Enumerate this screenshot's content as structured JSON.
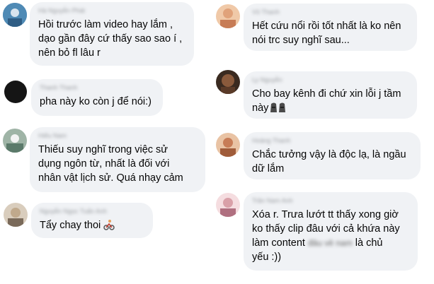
{
  "comments": [
    {
      "name": "Hà Nguyễn Phát",
      "text": "Hồi trước làm video hay lắm ,\ndạo gần đây cứ thấy sao sao í ,\nnên bỏ fl lâu r",
      "avatar_color": "#4f8ab5"
    },
    {
      "name": "Vũ Thanh",
      "text": "Hết cứu nổi rồi tốt nhất là ko nên\nnói trc suy nghĩ sau...",
      "avatar_color": "#e0a27a"
    },
    {
      "name": "Thanh Thanh",
      "text": "pha này ko còn j để nói:)",
      "avatar_color": "#151515"
    },
    {
      "name": "Ly Nguyễn",
      "text": "Cho bay kênh đi chứ xin lỗi j tầm\nnày",
      "avatar_color": "#8a5a3c"
    },
    {
      "name": "Hiếu Nam",
      "text": "Thiếu suy nghĩ trong việc sử\ndụng ngôn từ, nhất là đối với\nnhân vật lịch sử. Quá nhạy cảm",
      "avatar_color": "#5b7a6a"
    },
    {
      "name": "Hoàng Thanh",
      "text": "Chắc tưởng vậy là độc lạ, là ngầu\ndữ lắm",
      "avatar_color": "#c77c56"
    },
    {
      "name": "Nguyễn Ngọc Tuấn Anh",
      "text": "Tẩy chay thoi",
      "avatar_color": "#c0a98c"
    },
    {
      "name": "Trần Nam Anh",
      "text": "Xóa r. Trưa lướt tt thấy xong giờ\nko thấy clip đâu với cả khứa này\nlàm content",
      "text_tail": "là chủ\nyếu :))",
      "censored": "đâu về nam",
      "avatar_color": "#d9a0a8"
    }
  ]
}
